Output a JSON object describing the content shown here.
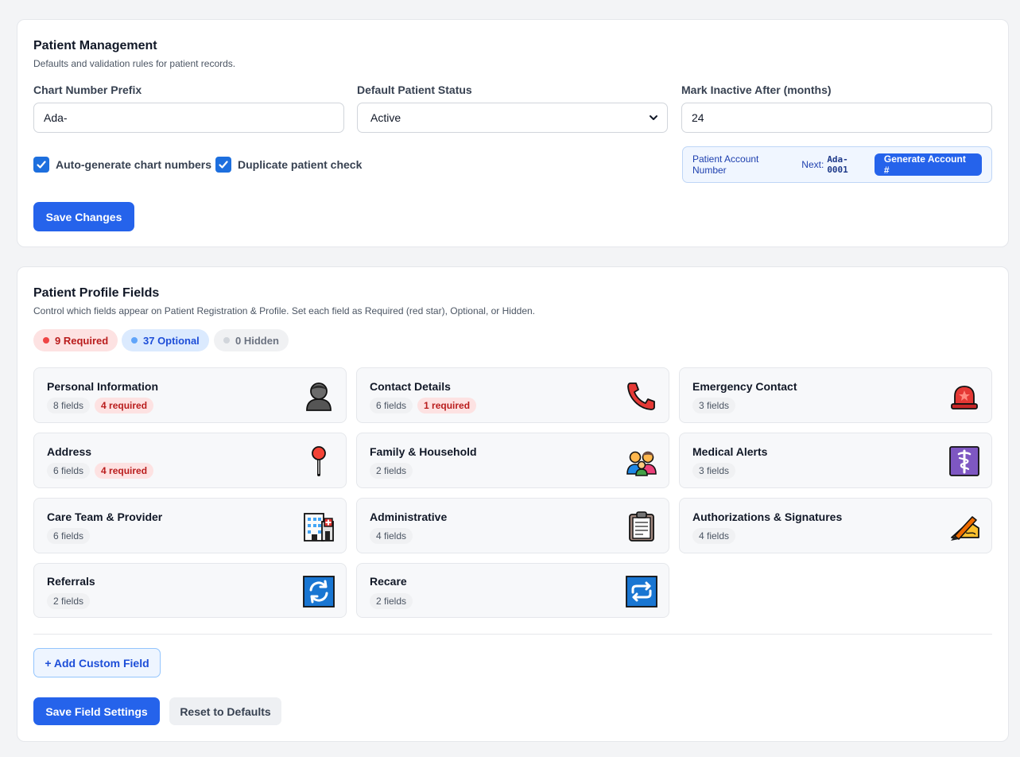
{
  "patient_management": {
    "title": "Patient Management",
    "subtitle": "Defaults and validation rules for patient records.",
    "chart_prefix_label": "Chart Number Prefix",
    "chart_prefix_value": "Ada-",
    "default_status_label": "Default Patient Status",
    "default_status_value": "Active",
    "inactive_label": "Mark Inactive After (months)",
    "inactive_value": "24",
    "auto_generate_label": "Auto-generate chart numbers",
    "duplicate_check_label": "Duplicate patient check",
    "account_number_label": "Patient Account Number",
    "next_label": "Next:",
    "next_value": "Ada-0001",
    "generate_button": "Generate Account #",
    "save_button": "Save Changes"
  },
  "profile_fields": {
    "title": "Patient Profile Fields",
    "subtitle": "Control which fields appear on Patient Registration & Profile. Set each field as Required (red star), Optional, or Hidden.",
    "summary": {
      "required": "9 Required",
      "optional": "37 Optional",
      "hidden": "0 Hidden"
    },
    "groups": [
      {
        "title": "Personal Information",
        "fields": "8 fields",
        "required": "4 required",
        "icon": "person-icon"
      },
      {
        "title": "Contact Details",
        "fields": "6 fields",
        "required": "1 required",
        "icon": "telephone-icon"
      },
      {
        "title": "Emergency Contact",
        "fields": "3 fields",
        "icon": "siren-icon"
      },
      {
        "title": "Address",
        "fields": "6 fields",
        "required": "4 required",
        "icon": "pushpin-icon"
      },
      {
        "title": "Family & Household",
        "fields": "2 fields",
        "icon": "family-icon"
      },
      {
        "title": "Medical Alerts",
        "fields": "3 fields",
        "icon": "medical-symbol-icon"
      },
      {
        "title": "Care Team & Provider",
        "fields": "6 fields",
        "icon": "hospital-icon"
      },
      {
        "title": "Administrative",
        "fields": "4 fields",
        "icon": "clipboard-icon"
      },
      {
        "title": "Authorizations & Signatures",
        "fields": "4 fields",
        "icon": "writing-hand-icon"
      },
      {
        "title": "Referrals",
        "fields": "2 fields",
        "icon": "refresh-arrows-icon"
      },
      {
        "title": "Recare",
        "fields": "2 fields",
        "icon": "repeat-arrows-icon"
      }
    ],
    "add_custom_button": "+ Add Custom Field",
    "save_button": "Save Field Settings",
    "reset_button": "Reset to Defaults"
  },
  "colors": {
    "primary": "#2563eb",
    "required_red": "#b91c1c",
    "optional_blue": "#1d4ed8"
  }
}
